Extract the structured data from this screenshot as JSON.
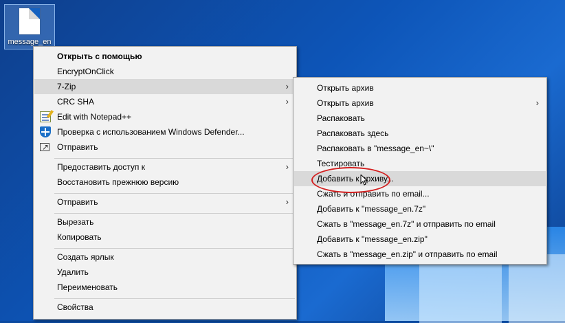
{
  "desktop": {
    "file_icon_label": "message_en"
  },
  "main_menu": {
    "items": [
      {
        "label": "Открыть с помощью",
        "bold": true
      },
      {
        "label": "EncryptOnClick"
      },
      {
        "label": "7-Zip",
        "submenu": true
      },
      {
        "label": "CRC SHA",
        "submenu": true
      },
      {
        "label": "Edit with Notepad++",
        "icon": "notepad-icon"
      },
      {
        "label": "Проверка с использованием Windows Defender...",
        "icon": "defender-shield-icon"
      },
      {
        "label": "Отправить",
        "icon": "share-icon"
      },
      {
        "label": "Предоставить доступ к",
        "submenu": true
      },
      {
        "label": "Восстановить прежнюю версию"
      },
      {
        "label": "Отправить",
        "submenu": true
      },
      {
        "label": "Вырезать"
      },
      {
        "label": "Копировать"
      },
      {
        "label": "Создать ярлык"
      },
      {
        "label": "Удалить"
      },
      {
        "label": "Переименовать"
      },
      {
        "label": "Свойства"
      }
    ]
  },
  "zip_menu": {
    "items": [
      {
        "label": "Открыть архив"
      },
      {
        "label": "Открыть архив",
        "submenu": true
      },
      {
        "label": "Распаковать"
      },
      {
        "label": "Распаковать здесь"
      },
      {
        "label": "Распаковать в \"message_en~\\\""
      },
      {
        "label": "Тестировать"
      },
      {
        "label": "Добавить к архиву..."
      },
      {
        "label": "Сжать и отправить по email..."
      },
      {
        "label": "Добавить к \"message_en.7z\""
      },
      {
        "label": "Сжать в \"message_en.7z\" и отправить по email"
      },
      {
        "label": "Добавить к \"message_en.zip\""
      },
      {
        "label": "Сжать в \"message_en.zip\" и отправить по email"
      }
    ]
  },
  "icons": {
    "submenu_arrow": "›"
  },
  "colors": {
    "menu_bg": "#f2f2f2",
    "highlight": "#d9d9d9",
    "annotation_ellipse": "#d42020"
  }
}
